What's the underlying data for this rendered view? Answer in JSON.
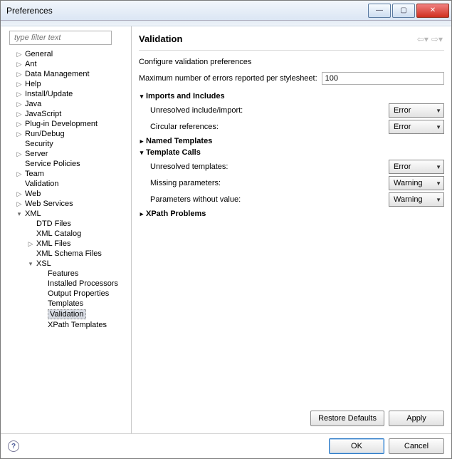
{
  "window": {
    "title": "Preferences"
  },
  "filter": {
    "placeholder": "type filter text"
  },
  "tree": {
    "items": [
      "General",
      "Ant",
      "Data Management",
      "Help",
      "Install/Update",
      "Java",
      "JavaScript",
      "Plug-in Development",
      "Run/Debug",
      "Security",
      "Server",
      "Service Policies",
      "Team",
      "Validation",
      "Web",
      "Web Services",
      "XML"
    ],
    "xml_children": [
      "DTD Files",
      "XML Catalog",
      "XML Files",
      "XML Schema Files",
      "XSL"
    ],
    "xsl_children": [
      "Features",
      "Installed Processors",
      "Output Properties",
      "Templates",
      "Validation",
      "XPath Templates"
    ]
  },
  "page": {
    "title": "Validation",
    "desc": "Configure validation preferences",
    "max_label": "Maximum number of errors reported per stylesheet:",
    "max_value": "100",
    "sections": {
      "imports": {
        "label": "Imports and Includes",
        "expanded": true
      },
      "named": {
        "label": "Named Templates",
        "expanded": false
      },
      "calls": {
        "label": "Template Calls",
        "expanded": true
      },
      "xpath": {
        "label": "XPath Problems",
        "expanded": false
      }
    },
    "opts": {
      "unresolved_include": {
        "label": "Unresolved include/import:",
        "value": "Error"
      },
      "circular": {
        "label": "Circular references:",
        "value": "Error"
      },
      "unresolved_tmpl": {
        "label": "Unresolved templates:",
        "value": "Error"
      },
      "missing_params": {
        "label": "Missing parameters:",
        "value": "Warning"
      },
      "params_no_value": {
        "label": "Parameters without value:",
        "value": "Warning"
      }
    }
  },
  "buttons": {
    "restore": "Restore Defaults",
    "apply": "Apply",
    "ok": "OK",
    "cancel": "Cancel"
  }
}
